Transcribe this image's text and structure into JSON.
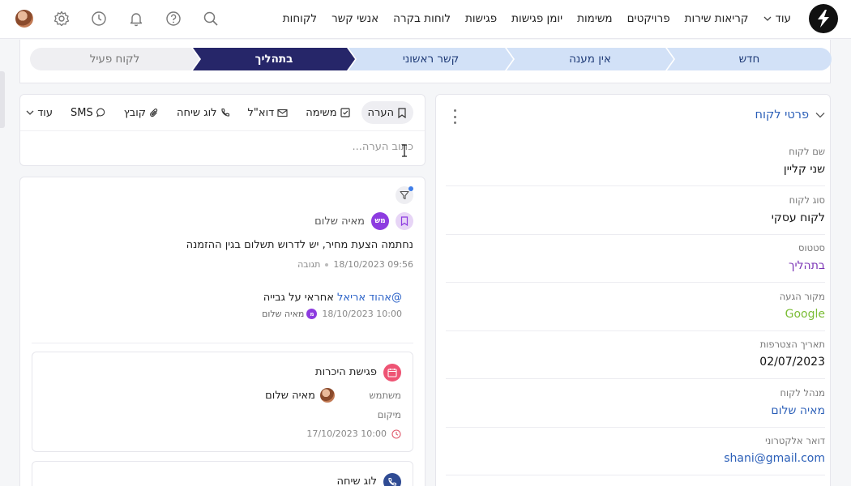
{
  "nav": {
    "items": [
      "לקוחות",
      "אנשי קשר",
      "לוחות בקרה",
      "פגישות",
      "יומן פגישות",
      "משימות",
      "פרויקטים",
      "קריאות שירות"
    ],
    "more_label": "עוד"
  },
  "pipeline": {
    "steps": [
      "חדש",
      "אין מענה",
      "קשר ראשוני",
      "בתהליך",
      "לקוח פעיל"
    ],
    "active": "בתהליך"
  },
  "composer": {
    "tabs": [
      "הערה",
      "משימה",
      "דוא\"ל",
      "לוג שיחה",
      "קובץ",
      "SMS"
    ],
    "more_label": "עוד",
    "placeholder": "כתוב הערה..."
  },
  "feed": {
    "note": {
      "author": "מאיה שלום",
      "author_initials": "מש",
      "text": "נחתמה הצעת מחיר, יש לדרוש תשלום בגין ההזמנה",
      "timestamp": "18/10/2023 09:56",
      "reply_label": "תגובה"
    },
    "reply": {
      "mention": "@אהוד אריאל",
      "text": " אחראי על גבייה",
      "timestamp": "18/10/2023 10:00",
      "author": "מאיה שלום",
      "author_initials": "מ"
    },
    "meeting": {
      "title": "פגישת היכרות",
      "user_label": "משתמש",
      "user": "מאיה שלום",
      "location_label": "מיקום",
      "time": "17/10/2023 10:00"
    },
    "call": {
      "title": "לוג שיחה"
    }
  },
  "details": {
    "title": "פרטי לקוח",
    "fields": [
      {
        "label": "שם לקוח",
        "value": "שני קליין"
      },
      {
        "label": "סוג לקוח",
        "value": "לקוח עסקי"
      },
      {
        "label": "סטטוס",
        "value": "בתהליך"
      },
      {
        "label": "מקור הגעה",
        "value": "Google"
      },
      {
        "label": "תאריך הצטרפות",
        "value": "02/07/2023"
      },
      {
        "label": "מנהל לקוח",
        "value": "מאיה שלום"
      },
      {
        "label": "דואר אלקטרוני",
        "value": "shani@gmail.com"
      }
    ]
  },
  "colors": {
    "accent": "#262669",
    "step_inactive": "#d2e1f7",
    "link": "#2b5fb8",
    "status_purple": "#7a33b5",
    "source_green": "#7bbd36"
  }
}
